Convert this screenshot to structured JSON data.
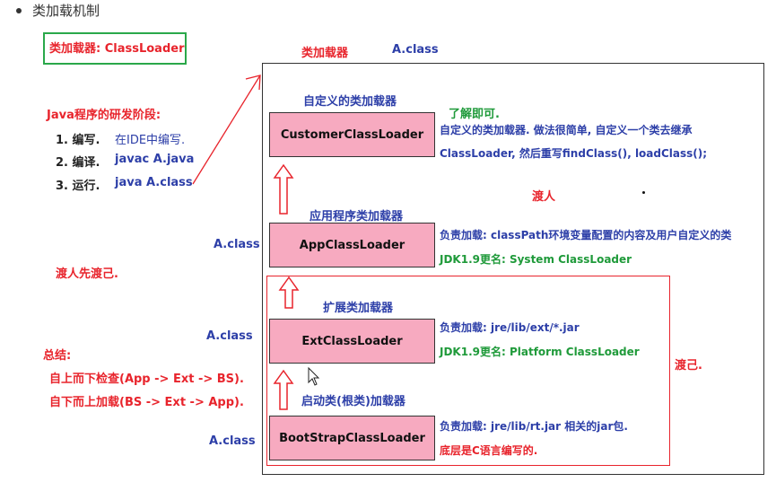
{
  "heading": "类加载机制",
  "classloader_label": "类加载器: ClassLoader",
  "top_labels": {
    "loader": "类加载器",
    "aclass": "A.class"
  },
  "dev_stages": {
    "title": "Java程序的研发阶段:",
    "steps": [
      {
        "num": "1. 编写.",
        "desc": "在IDE中编写."
      },
      {
        "num": "2. 编译.",
        "desc": "javac A.java"
      },
      {
        "num": "3. 运行.",
        "desc": "java A.class"
      }
    ]
  },
  "left_notes": {
    "aclass_labels": [
      "A.class",
      "A.class",
      "A.class"
    ],
    "ferry_first": "渡人先渡己.",
    "summary_title": "总结:",
    "summary_lines": [
      "自上而下检查(App -> Ext -> BS).",
      "自下而上加载(BS -> Ext -> App)."
    ]
  },
  "loaders": [
    {
      "caption": "自定义的类加载器",
      "name": "CustomerClassLoader",
      "desc": [
        "自定义的类加载器. 做法很简单, 自定义一个类去继承",
        "ClassLoader, 然后重写findClass(), loadClass();"
      ],
      "note": "了解即可."
    },
    {
      "caption": "应用程序类加载器",
      "name": "AppClassLoader",
      "desc": [
        "负责加载: classPath环境变量配置的内容及用户自定义的类",
        "JDK1.9更名: System ClassLoader"
      ]
    },
    {
      "caption": "扩展类加载器",
      "name": "ExtClassLoader",
      "desc": [
        "负责加载: jre/lib/ext/*.jar",
        "JDK1.9更名: Platform ClassLoader"
      ]
    },
    {
      "caption": "启动类(根类)加载器",
      "name": "BootStrapClassLoader",
      "desc": [
        "负责加载: jre/lib/rt.jar 相关的jar包.",
        "底层是C语言编写的."
      ]
    }
  ],
  "right_notes": {
    "ferry_others": "渡人",
    "ferry_self": "渡己."
  },
  "colors": {
    "pink_box": "#f7aac0",
    "red": "#e8242c",
    "blue": "#2d3fa8",
    "green": "#1f9a3a"
  },
  "icons": [
    "bullet-icon",
    "up-arrow-icon",
    "diagonal-arrow-icon",
    "mouse-cursor-icon"
  ]
}
